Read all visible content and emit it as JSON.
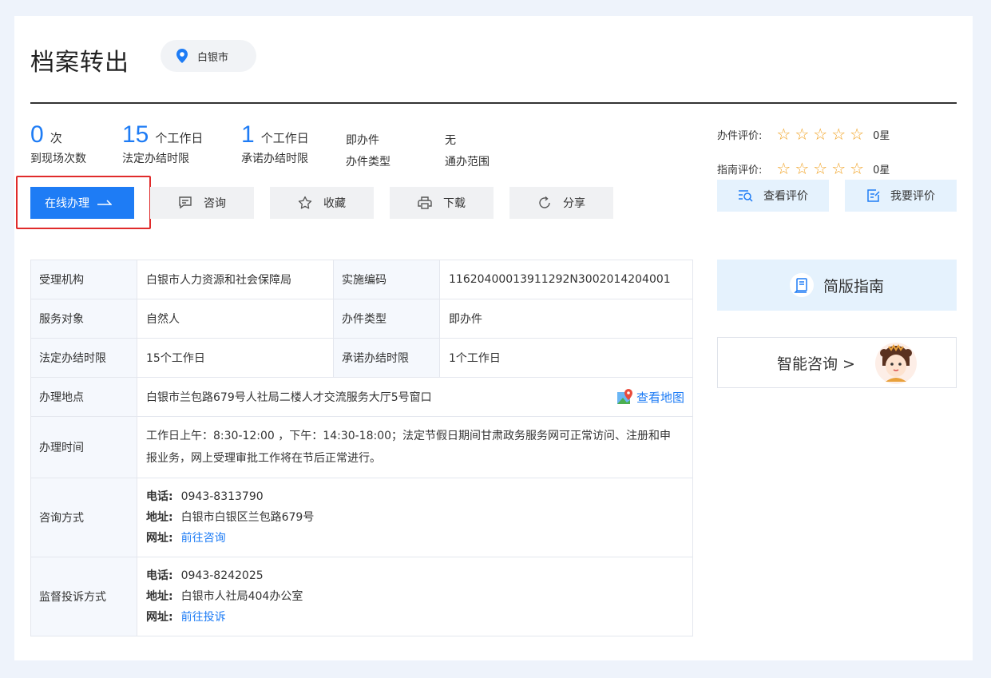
{
  "page": {
    "title": "档案转出",
    "location": "白银市"
  },
  "stats": [
    {
      "num": "0",
      "unit": "次",
      "caption": "到现场次数"
    },
    {
      "num": "15",
      "unit": "个工作日",
      "caption": "法定办结时限"
    },
    {
      "num": "1",
      "unit": "个工作日",
      "caption": "承诺办结时限"
    }
  ],
  "stats2": [
    {
      "value": "即办件",
      "caption": "办件类型"
    },
    {
      "value": "无",
      "caption": "通办范围"
    }
  ],
  "actions": {
    "online": "在线办理",
    "consult": "咨询",
    "favorite": "收藏",
    "download": "下载",
    "share": "分享"
  },
  "ratings": {
    "handling_label": "办件评价:",
    "handling_score": "0星",
    "guide_label": "指南评价:",
    "guide_score": "0星",
    "view_label": "查看评价",
    "rate_label": "我要评价"
  },
  "table": {
    "org_label": "受理机构",
    "org_value": "白银市人力资源和社会保障局",
    "code_label": "实施编码",
    "code_value": "11620400013911292N3002014204001",
    "target_label": "服务对象",
    "target_value": "自然人",
    "type_label": "办件类型",
    "type_value": "即办件",
    "legal_label": "法定办结时限",
    "legal_value": "15个工作日",
    "promise_label": "承诺办结时限",
    "promise_value": "1个工作日",
    "place_label": "办理地点",
    "place_value": "白银市兰包路679号人社局二楼人才交流服务大厅5号窗口",
    "map_link": "查看地图",
    "time_label": "办理时间",
    "time_value": "工作日上午：8:30-12:00 ，下午：14:30-18:00；法定节假日期间甘肃政务服务网可正常访问、注册和申报业务，网上受理审批工作将在节后正常进行。",
    "consult_label": "咨询方式",
    "consult_phone_key": "电话:",
    "consult_phone": "0943-8313790",
    "consult_addr_key": "地址:",
    "consult_addr": "白银市白银区兰包路679号",
    "consult_web_key": "网址:",
    "consult_web": "前往咨询",
    "complaint_label": "监督投诉方式",
    "complaint_phone_key": "电话:",
    "complaint_phone": "0943-8242025",
    "complaint_addr_key": "地址:",
    "complaint_addr": "白银市人社局404办公室",
    "complaint_web_key": "网址:",
    "complaint_web": "前往投诉"
  },
  "side": {
    "guide_label": "简版指南",
    "ai_label": "智能咨询 >"
  },
  "colors": {
    "accent": "#1e7cf5",
    "star": "#f1a325",
    "highlight": "#e02b2b"
  }
}
